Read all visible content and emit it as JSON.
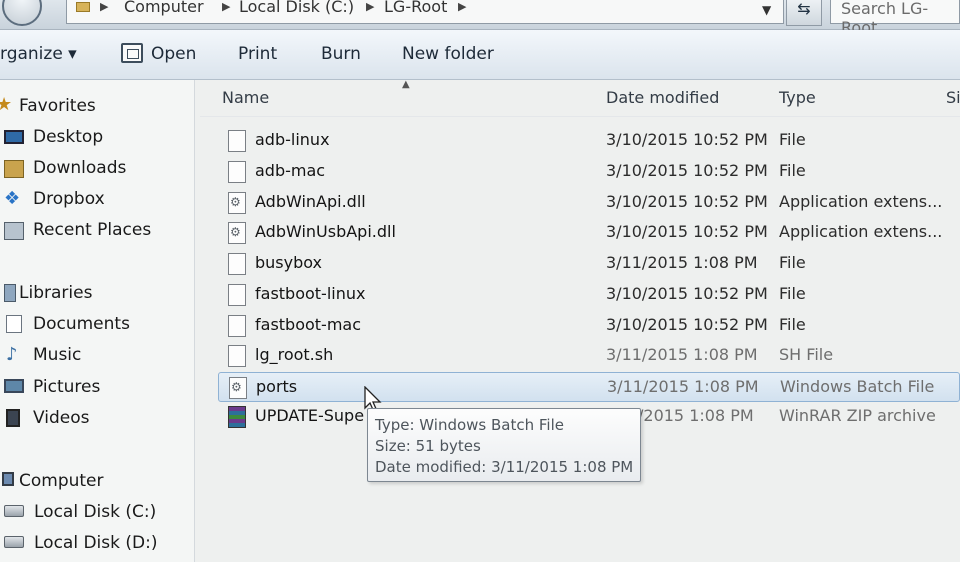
{
  "address_bar": {
    "crumbs": [
      "Computer",
      "Local Disk (C:)",
      "LG-Root"
    ],
    "search_placeholder": "Search LG-Root"
  },
  "toolbar": {
    "organize": "rganize ▾",
    "open": "Open",
    "print": "Print",
    "burn": "Burn",
    "new_folder": "New folder"
  },
  "nav": {
    "favorites": "Favorites",
    "desktop": "Desktop",
    "downloads": "Downloads",
    "dropbox": "Dropbox",
    "recent_places": "Recent Places",
    "libraries": "Libraries",
    "documents": "Documents",
    "music": "Music",
    "pictures": "Pictures",
    "videos": "Videos",
    "computer": "Computer",
    "disk_c": "Local Disk (C:)",
    "disk_d": "Local Disk (D:)"
  },
  "columns": {
    "name": "Name",
    "date": "Date modified",
    "type": "Type",
    "size": "Si"
  },
  "files": [
    {
      "name": "adb-linux",
      "date": "3/10/2015 10:52 PM",
      "type": "File"
    },
    {
      "name": "adb-mac",
      "date": "3/10/2015 10:52 PM",
      "type": "File"
    },
    {
      "name": "AdbWinApi.dll",
      "date": "3/10/2015 10:52 PM",
      "type": "Application extens..."
    },
    {
      "name": "AdbWinUsbApi.dll",
      "date": "3/10/2015 10:52 PM",
      "type": "Application extens..."
    },
    {
      "name": "busybox",
      "date": "3/11/2015 1:08 PM",
      "type": "File"
    },
    {
      "name": "fastboot-linux",
      "date": "3/10/2015 10:52 PM",
      "type": "File"
    },
    {
      "name": "fastboot-mac",
      "date": "3/10/2015 10:52 PM",
      "type": "File"
    },
    {
      "name": "lg_root.sh",
      "date": "3/11/2015 1:08 PM",
      "type": "SH File"
    },
    {
      "name": "ports",
      "date": "3/11/2015 1:08 PM",
      "type": "Windows Batch File"
    },
    {
      "name": "UPDATE-Supe",
      "date": "/2015 1:08 PM",
      "type": "WinRAR ZIP archive"
    }
  ],
  "tooltip": {
    "type": "Type: Windows Batch File",
    "size": "Size: 51 bytes",
    "date": "Date modified: 3/11/2015 1:08 PM"
  }
}
